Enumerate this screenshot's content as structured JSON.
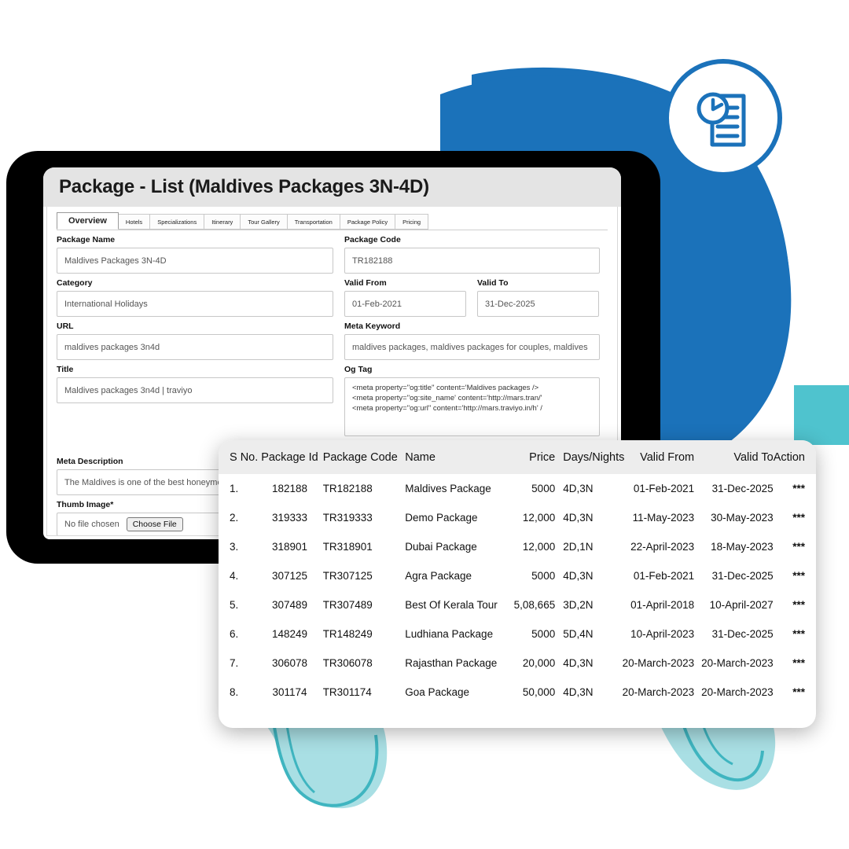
{
  "window": {
    "title": "Package - List (Maldives Packages 3N-4D)"
  },
  "tabs": [
    {
      "label": "Overview",
      "active": true
    },
    {
      "label": "Hotels",
      "active": false
    },
    {
      "label": "Specializations",
      "active": false
    },
    {
      "label": "Itinerary",
      "active": false
    },
    {
      "label": "Tour Gallery",
      "active": false
    },
    {
      "label": "Transportation",
      "active": false
    },
    {
      "label": "Package Policy",
      "active": false
    },
    {
      "label": "Pricing",
      "active": false
    }
  ],
  "form": {
    "package_name": {
      "label": "Package Name",
      "value": "Maldives Packages 3N-4D"
    },
    "package_code": {
      "label": "Package Code",
      "value": "TR182188"
    },
    "category": {
      "label": "Category",
      "value": "International Holidays"
    },
    "valid_from": {
      "label": "Valid From",
      "value": "01-Feb-2021"
    },
    "valid_to": {
      "label": "Valid To",
      "value": "31-Dec-2025"
    },
    "url": {
      "label": "URL",
      "value": "maldives packages 3n4d"
    },
    "meta_keyword": {
      "label": "Meta Keyword",
      "value": "maldives packages, maldives packages for couples, maldives"
    },
    "title_field": {
      "label": "Title",
      "value": "Maldives packages 3n4d | traviyo"
    },
    "og_tag": {
      "label": "Og Tag",
      "lines": [
        "<meta property=\"og:title\" content='Maldives packages />",
        "<meta property=\"og:site_name' content='http://mars.tran/'",
        "<meta property=\"og:url\" content='http://mars.traviyo.in/h' /"
      ]
    },
    "meta_description": {
      "label": "Meta Description",
      "value": "The Maldives is one of the best honeymo"
    },
    "thumb_image": {
      "label": "Thumb Image*",
      "file_status": "No file chosen",
      "button_label": "Choose File"
    }
  },
  "table": {
    "columns": [
      "S No.",
      "Package Id",
      "Package Code",
      "Name",
      "Price",
      "Days/Nights",
      "Valid From",
      "Valid To",
      "Action"
    ],
    "rows": [
      {
        "sno": "1.",
        "package_id": "182188",
        "package_code": "TR182188",
        "name": "Maldives Package",
        "price": "5000",
        "days_nights": "4D,3N",
        "valid_from": "01-Feb-2021",
        "valid_to": "31-Dec-2025",
        "action": "***"
      },
      {
        "sno": "2.",
        "package_id": "319333",
        "package_code": "TR319333",
        "name": "Demo Package",
        "price": "12,000",
        "days_nights": "4D,3N",
        "valid_from": "11-May-2023",
        "valid_to": "30-May-2023",
        "action": "***"
      },
      {
        "sno": "3.",
        "package_id": "318901",
        "package_code": "TR318901",
        "name": "Dubai Package",
        "price": "12,000",
        "days_nights": "2D,1N",
        "valid_from": "22-April-2023",
        "valid_to": "18-May-2023",
        "action": "***"
      },
      {
        "sno": "4.",
        "package_id": "307125",
        "package_code": "TR307125",
        "name": "Agra Package",
        "price": "5000",
        "days_nights": "4D,3N",
        "valid_from": "01-Feb-2021",
        "valid_to": "31-Dec-2025",
        "action": "***"
      },
      {
        "sno": "5.",
        "package_id": "307489",
        "package_code": "TR307489",
        "name": "Best Of Kerala Tour",
        "price": "5,08,665",
        "days_nights": "3D,2N",
        "valid_from": "01-April-2018",
        "valid_to": "10-April-2027",
        "action": "***"
      },
      {
        "sno": "6.",
        "package_id": "148249",
        "package_code": "TR148249",
        "name": "Ludhiana Package",
        "price": "5000",
        "days_nights": "5D,4N",
        "valid_from": "10-April-2023",
        "valid_to": "31-Dec-2025",
        "action": "***"
      },
      {
        "sno": "7.",
        "package_id": "306078",
        "package_code": "TR306078",
        "name": "Rajasthan Package",
        "price": "20,000",
        "days_nights": "4D,3N",
        "valid_from": "20-March-2023",
        "valid_to": "20-March-2023",
        "action": "***"
      },
      {
        "sno": "8.",
        "package_id": "301174",
        "package_code": "TR301174",
        "name": "Goa Package",
        "price": "50,000",
        "days_nights": "4D,3N",
        "valid_from": "20-March-2023",
        "valid_to": "20-March-2023",
        "action": "***"
      }
    ]
  },
  "decor": {
    "badge_icon": "document-clock-icon",
    "blue": "#1B72BA",
    "teal": "#4FC3CE",
    "frame": "#000000"
  }
}
